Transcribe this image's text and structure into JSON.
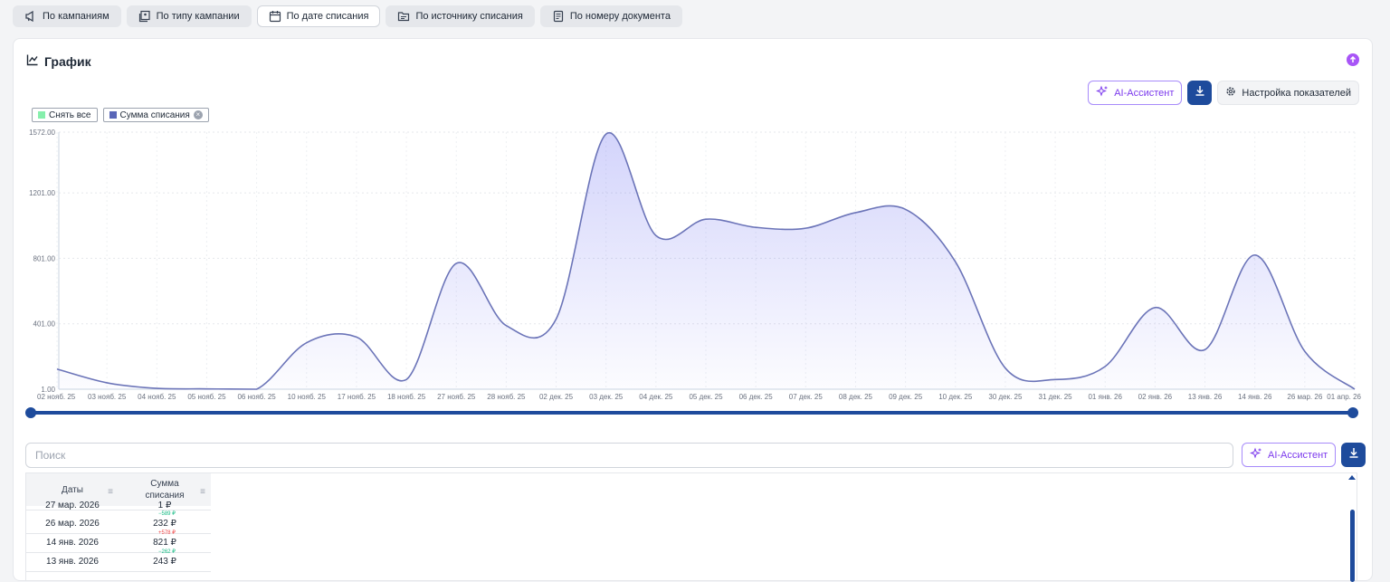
{
  "tabs": [
    {
      "label": "По кампаниям",
      "icon": "megaphone-icon",
      "active": false
    },
    {
      "label": "По типу кампании",
      "icon": "campaign-type-icon",
      "active": false
    },
    {
      "label": "По дате списания",
      "icon": "calendar-icon",
      "active": true
    },
    {
      "label": "По источнику списания",
      "icon": "folder-icon",
      "active": false
    },
    {
      "label": "По номеру документа",
      "icon": "document-icon",
      "active": false
    }
  ],
  "card": {
    "title": "График"
  },
  "toolbar": {
    "ai_label": "AI-Ассистент",
    "settings_label": "Настройка показателей"
  },
  "legend": {
    "clear_label": "Снять все",
    "series_label": "Сумма списания",
    "clear_color": "#86efac",
    "series_color": "#5a67b8"
  },
  "chart_data": {
    "type": "area",
    "x": [
      "02 нояб. 25",
      "03 нояб. 25",
      "04 нояб. 25",
      "05 нояб. 25",
      "06 нояб. 25",
      "10 нояб. 25",
      "17 нояб. 25",
      "18 нояб. 25",
      "27 нояб. 25",
      "28 нояб. 25",
      "02 дек. 25",
      "03 дек. 25",
      "04 дек. 25",
      "05 дек. 25",
      "06 дек. 25",
      "07 дек. 25",
      "08 дек. 25",
      "09 дек. 25",
      "10 дек. 25",
      "30 дек. 25",
      "31 дек. 25",
      "01 янв. 26",
      "02 янв. 26",
      "13 янв. 26",
      "14 янв. 26",
      "26 мар. 26",
      "01 апр. 26"
    ],
    "series": [
      {
        "name": "Сумма списания",
        "values": [
          124,
          40,
          6,
          3,
          1,
          285,
          320,
          60,
          770,
          390,
          430,
          1560,
          940,
          1040,
          990,
          985,
          1080,
          1100,
          780,
          130,
          60,
          140,
          500,
          243,
          821,
          232,
          1
        ]
      }
    ],
    "yticks": [
      "1572.00",
      "1201.00",
      "801.00",
      "401.00",
      "1.00"
    ],
    "ylim": [
      1,
      1572
    ],
    "grid": true,
    "legend": "top-left",
    "fill_color": "#6366f1",
    "line_color": "#6b74b8"
  },
  "search": {
    "placeholder": "Поиск"
  },
  "table": {
    "headers": [
      "Даты",
      "Сумма\nсписания"
    ],
    "rows": [
      {
        "date": "27 мар. 2026",
        "amount": "1 ₽",
        "delta": "",
        "delta_color": ""
      },
      {
        "date": "26 мар. 2026",
        "amount": "232 ₽",
        "delta": "−589 ₽",
        "delta_color": "#10b981"
      },
      {
        "date": "14 янв. 2026",
        "amount": "821 ₽",
        "delta": "+578 ₽",
        "delta_color": "#ef4444"
      },
      {
        "date": "13 янв. 2026",
        "amount": "243 ₽",
        "delta": "−262 ₽",
        "delta_color": "#10b981"
      }
    ]
  }
}
